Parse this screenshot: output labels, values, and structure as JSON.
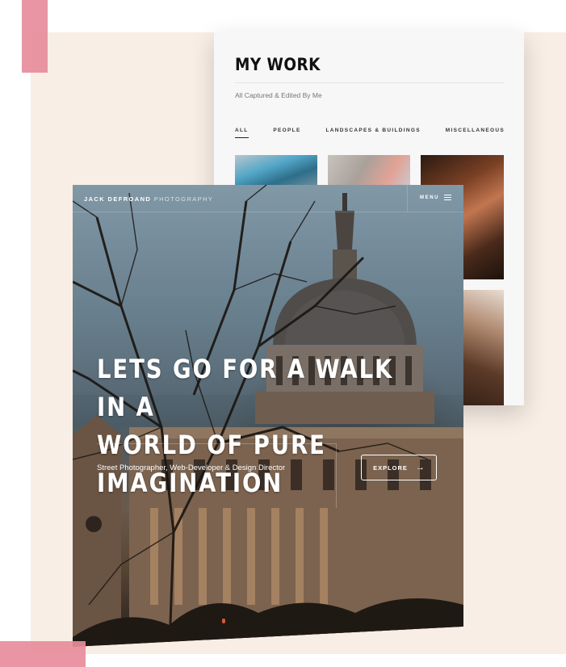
{
  "portfolio": {
    "title": "MY WORK",
    "subtitle": "All Captured & Edited By Me",
    "tabs": [
      {
        "label": "ALL",
        "active": true
      },
      {
        "label": "PEOPLE",
        "active": false
      },
      {
        "label": "LANDSCAPES & BUILDINGS",
        "active": false
      },
      {
        "label": "MISCELLANEOUS",
        "active": false
      }
    ]
  },
  "hero": {
    "brand_strong": "JACK DEFROAND",
    "brand_light": "PHOTOGRAPHY",
    "menu_label": "MENU",
    "headline_line1": "LETS GO FOR A WALK IN A",
    "headline_line2": "WORLD OF PURE IMAGINATION",
    "tagline": "Street Photographer, Web-Developer & Design Director",
    "explore_label": "EXPLORE",
    "arrow_glyph": "→"
  },
  "colors": {
    "background_panel": "#f8eee6",
    "accent_pink": "#e78c9b",
    "card_background": "#f7f7f7"
  }
}
